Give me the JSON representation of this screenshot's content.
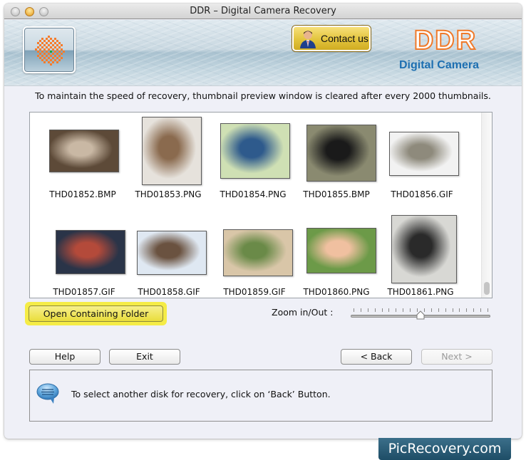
{
  "window": {
    "title": "DDR – Digital Camera Recovery",
    "controls": [
      "close",
      "minimize",
      "zoom"
    ]
  },
  "header": {
    "logo_icon": "ddr-app-logo-icon",
    "contact_button": {
      "label": "Contact us",
      "icon": "person-icon"
    },
    "brand_title": "DDR",
    "brand_subtitle": "Digital Camera",
    "colors": {
      "brand_orange": "#f07a2a",
      "brand_blue": "#1d6fb1"
    }
  },
  "notice": "To maintain the speed of recovery, thumbnail preview window is cleared after every 2000 thumbnails.",
  "thumbnails": [
    {
      "name": "THD01852.BMP",
      "tone": [
        "#5d4a38",
        "#c9b8a4"
      ]
    },
    {
      "name": "THD01853.PNG",
      "tone": [
        "#e6e2dc",
        "#8a6a4e"
      ]
    },
    {
      "name": "THD01854.PNG",
      "tone": [
        "#cfe0b4",
        "#2e5a8c"
      ]
    },
    {
      "name": "THD01855.BMP",
      "tone": [
        "#8a8a70",
        "#1a1a1a"
      ]
    },
    {
      "name": "THD01856.GIF",
      "tone": [
        "#f2f2f2",
        "#8e8a7c"
      ]
    },
    {
      "name": "THD01857.GIF",
      "tone": [
        "#2a3448",
        "#b44a3a"
      ]
    },
    {
      "name": "THD01858.GIF",
      "tone": [
        "#dfe8f2",
        "#6a5240"
      ]
    },
    {
      "name": "THD01859.GIF",
      "tone": [
        "#d9c6a8",
        "#6a8a48"
      ]
    },
    {
      "name": "THD01860.PNG",
      "tone": [
        "#6c9a48",
        "#f0c0a0"
      ]
    },
    {
      "name": "THD01861.PNG",
      "tone": [
        "#d8d8d4",
        "#2a2a2a"
      ]
    }
  ],
  "actions": {
    "open_folder": "Open Containing Folder",
    "zoom_label": "Zoom in/Out :",
    "zoom_level_percent": 50
  },
  "buttons": {
    "help": "Help",
    "exit": "Exit",
    "back": "< Back",
    "next": "Next >"
  },
  "message": {
    "icon": "speech-bubble-icon",
    "text": "To select another disk for recovery, click on ‘Back’ Button."
  },
  "watermark": "PicRecovery.com"
}
